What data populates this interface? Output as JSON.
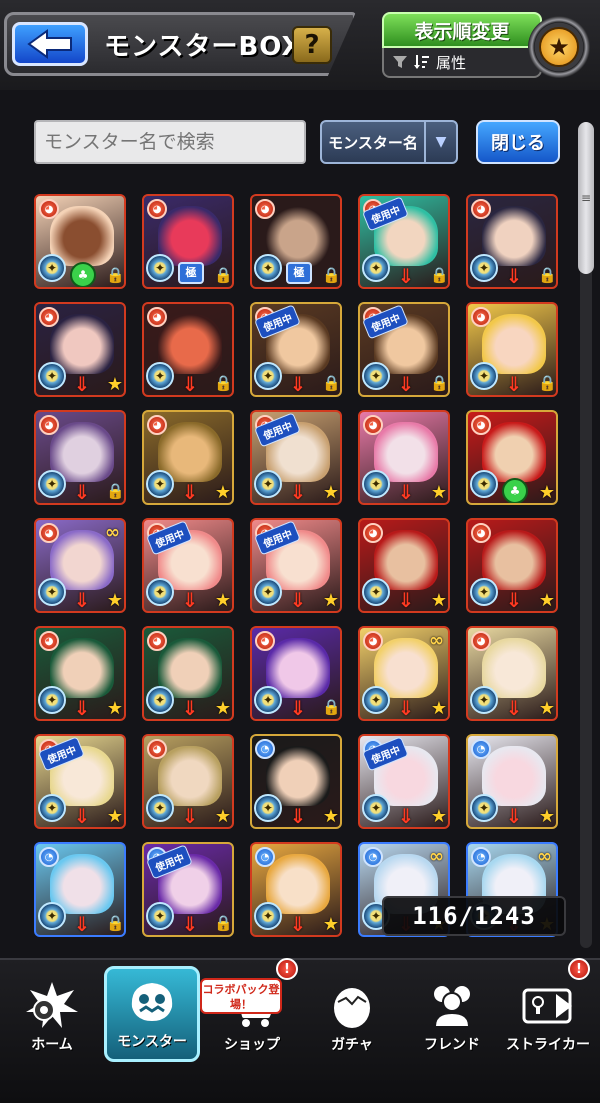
{
  "header": {
    "title": "モンスターBOX",
    "help_label": "?",
    "sort_button": "表示順変更",
    "sort_sub_label": "属性",
    "back_icon": "back-arrow-icon",
    "star_icon": "star-icon"
  },
  "search": {
    "placeholder": "モンスター名で検索",
    "filter_label": "モンスター名",
    "close_label": "閉じる"
  },
  "box": {
    "count_text": "116/1243",
    "monsters": [
      {
        "element": "fire",
        "frame": "red",
        "lock": "lock",
        "badge": "clover",
        "used": false,
        "link": false
      },
      {
        "element": "fire",
        "frame": "red",
        "lock": "lock",
        "badge": "kyoku",
        "used": false,
        "link": false
      },
      {
        "element": "fire",
        "frame": "red",
        "lock": "lock",
        "badge": "kyoku",
        "used": false,
        "link": false
      },
      {
        "element": "fire",
        "frame": "red",
        "lock": "lock",
        "badge": "arrow",
        "used": true,
        "link": false
      },
      {
        "element": "fire",
        "frame": "red",
        "lock": "lock",
        "badge": "arrow",
        "used": false,
        "link": false
      },
      {
        "element": "fire",
        "frame": "red",
        "lock": "star",
        "badge": "arrow",
        "used": false,
        "link": false
      },
      {
        "element": "fire",
        "frame": "red",
        "lock": "lock",
        "badge": "arrow",
        "used": false,
        "link": false
      },
      {
        "element": "fire",
        "frame": "gold",
        "lock": "lock",
        "badge": "arrow",
        "used": true,
        "link": false
      },
      {
        "element": "fire",
        "frame": "gold",
        "lock": "lock",
        "badge": "arrow",
        "used": true,
        "link": false
      },
      {
        "element": "fire",
        "frame": "red",
        "lock": "lock",
        "badge": "arrow",
        "used": false,
        "link": false
      },
      {
        "element": "fire",
        "frame": "red",
        "lock": "lock",
        "badge": "arrow",
        "used": false,
        "link": false
      },
      {
        "element": "fire",
        "frame": "gold",
        "lock": "star",
        "badge": "arrow",
        "used": false,
        "link": false
      },
      {
        "element": "fire",
        "frame": "red",
        "lock": "star",
        "badge": "arrow",
        "used": true,
        "link": false
      },
      {
        "element": "fire",
        "frame": "red",
        "lock": "star",
        "badge": "arrow",
        "used": false,
        "link": false
      },
      {
        "element": "fire",
        "frame": "gold",
        "lock": "star",
        "badge": "clover",
        "used": false,
        "link": false
      },
      {
        "element": "fire",
        "frame": "red",
        "lock": "star",
        "badge": "arrow",
        "used": false,
        "link": true
      },
      {
        "element": "fire",
        "frame": "red",
        "lock": "star",
        "badge": "arrow",
        "used": true,
        "link": false
      },
      {
        "element": "fire",
        "frame": "red",
        "lock": "star",
        "badge": "arrow",
        "used": true,
        "link": false
      },
      {
        "element": "fire",
        "frame": "red",
        "lock": "star",
        "badge": "arrow",
        "used": false,
        "link": false
      },
      {
        "element": "fire",
        "frame": "red",
        "lock": "star",
        "badge": "arrow",
        "used": false,
        "link": false
      },
      {
        "element": "fire",
        "frame": "red",
        "lock": "star",
        "badge": "arrow",
        "used": false,
        "link": false
      },
      {
        "element": "fire",
        "frame": "red",
        "lock": "star",
        "badge": "arrow",
        "used": false,
        "link": false
      },
      {
        "element": "fire",
        "frame": "red",
        "lock": "lock",
        "badge": "arrow",
        "used": false,
        "link": false
      },
      {
        "element": "fire",
        "frame": "red",
        "lock": "star",
        "badge": "arrow",
        "used": false,
        "link": true
      },
      {
        "element": "fire",
        "frame": "red",
        "lock": "star",
        "badge": "arrow",
        "used": false,
        "link": false
      },
      {
        "element": "fire",
        "frame": "red",
        "lock": "star",
        "badge": "arrow",
        "used": true,
        "link": false
      },
      {
        "element": "fire",
        "frame": "red",
        "lock": "star",
        "badge": "arrow",
        "used": false,
        "link": false
      },
      {
        "element": "water",
        "frame": "gold",
        "lock": "star",
        "badge": "arrow",
        "used": false,
        "link": false
      },
      {
        "element": "water",
        "frame": "red",
        "lock": "star",
        "badge": "arrow",
        "used": true,
        "link": false
      },
      {
        "element": "water",
        "frame": "gold",
        "lock": "star",
        "badge": "arrow",
        "used": false,
        "link": false
      },
      {
        "element": "water",
        "frame": "blue",
        "lock": "lock",
        "badge": "arrow",
        "used": false,
        "link": false
      },
      {
        "element": "water",
        "frame": "gold",
        "lock": "lock",
        "badge": "arrow",
        "used": true,
        "link": false
      },
      {
        "element": "water",
        "frame": "red",
        "lock": "star",
        "badge": "arrow",
        "used": false,
        "link": false
      },
      {
        "element": "water",
        "frame": "blue",
        "lock": "star",
        "badge": "arrow",
        "used": false,
        "link": true
      },
      {
        "element": "water",
        "frame": "blue",
        "lock": "star",
        "badge": "arrow",
        "used": false,
        "link": true
      }
    ]
  },
  "used_label": "使用中",
  "kyoku_label": "極",
  "nav": {
    "items": [
      {
        "label": "ホーム",
        "icon": "home-burst-icon"
      },
      {
        "label": "モンスター",
        "icon": "monster-face-icon"
      },
      {
        "label": "ショップ",
        "icon": "cart-icon"
      },
      {
        "label": "ガチャ",
        "icon": "egg-icon"
      },
      {
        "label": "フレンド",
        "icon": "friends-icon"
      },
      {
        "label": "ストライカー",
        "icon": "striker-card-icon"
      }
    ],
    "collab_tag": "コラボパック登場！",
    "alert_mark": "!",
    "active_index": 1
  },
  "colors": {
    "fire_frame": "#d23a1f",
    "gold_frame": "#d6a83a",
    "water_frame": "#3b7cff",
    "accent_green": "#2f8f1f",
    "accent_blue": "#1557c9"
  }
}
